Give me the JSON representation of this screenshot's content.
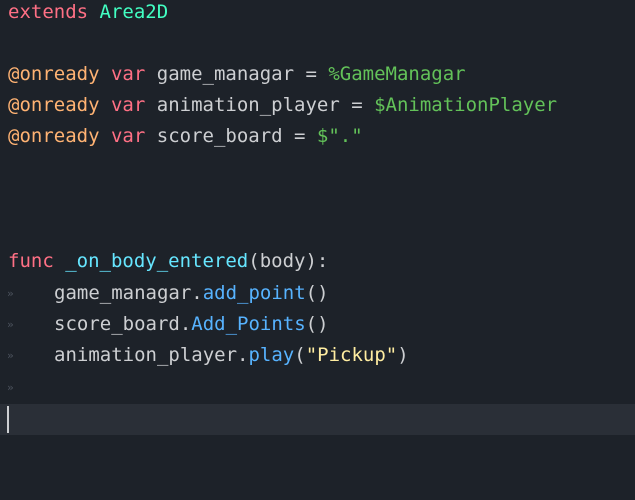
{
  "lines": {
    "l1": {
      "kw": "extends",
      "cls": "Area2D"
    },
    "l3": {
      "ann": "@onready",
      "kw": "var",
      "name": "game_managar = ",
      "node": "%GameManagar"
    },
    "l4": {
      "ann": "@onready",
      "kw": "var",
      "name": "animation_player = ",
      "node": "$AnimationPlayer"
    },
    "l5": {
      "ann": "@onready",
      "kw": "var",
      "name": "score_board = ",
      "node": "$\".\""
    },
    "l9": {
      "kw": "func",
      "fname": "_on_body_entered",
      "args": "(body):"
    },
    "l10": {
      "obj": "game_managar.",
      "call": "add_point",
      "args": "()"
    },
    "l11": {
      "obj": "score_board.",
      "call": "Add_Points",
      "args": "()"
    },
    "l12": {
      "obj": "animation_player.",
      "call": "play",
      "open": "(",
      "str": "\"Pickup\"",
      "close": ")"
    }
  },
  "tab_marker": "»",
  "colors": {
    "background": "#1d2229",
    "current_line": "#2a2f37",
    "keyword": "#ff7085",
    "annotation": "#ffb373",
    "class_name": "#42ffc2",
    "node_path": "#63c259",
    "string": "#ffeda1",
    "function_call": "#57b3ff",
    "function_decl": "#66e6ff",
    "text": "#cdcfd2"
  }
}
